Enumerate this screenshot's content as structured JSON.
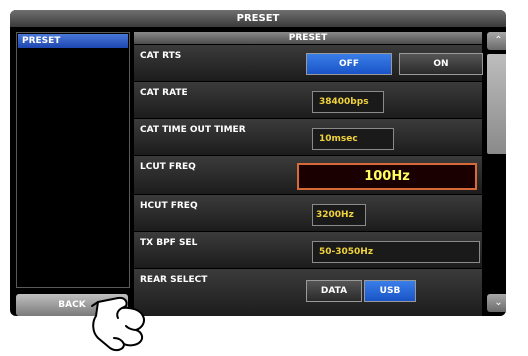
{
  "title": "PRESET",
  "left_panel": {
    "items": [
      {
        "label": "PRESET",
        "selected": true
      }
    ]
  },
  "back_label": "BACK",
  "main": {
    "header": "PRESET",
    "rows": [
      {
        "label": "CAT RTS",
        "options": [
          "OFF",
          "ON"
        ],
        "selected": "OFF"
      },
      {
        "label": "CAT RATE",
        "value": "38400bps"
      },
      {
        "label": "CAT TIME OUT TIMER",
        "value": "10msec"
      },
      {
        "label": "LCUT FREQ",
        "value": "100Hz",
        "focused": true
      },
      {
        "label": "HCUT FREQ",
        "value": "3200Hz"
      },
      {
        "label": "TX BPF SEL",
        "value": "50-3050Hz"
      },
      {
        "label": "REAR SELECT",
        "options": [
          "DATA",
          "USB"
        ],
        "selected": "USB"
      }
    ]
  },
  "colors": {
    "accent": "#1d47b0",
    "value_text": "#f0d23c",
    "focus_border": "#d86a3a"
  },
  "icons": {
    "scroll_up": "chevron-up-icon",
    "scroll_down": "chevron-down-icon",
    "pointer": "pointing-hand-icon"
  }
}
